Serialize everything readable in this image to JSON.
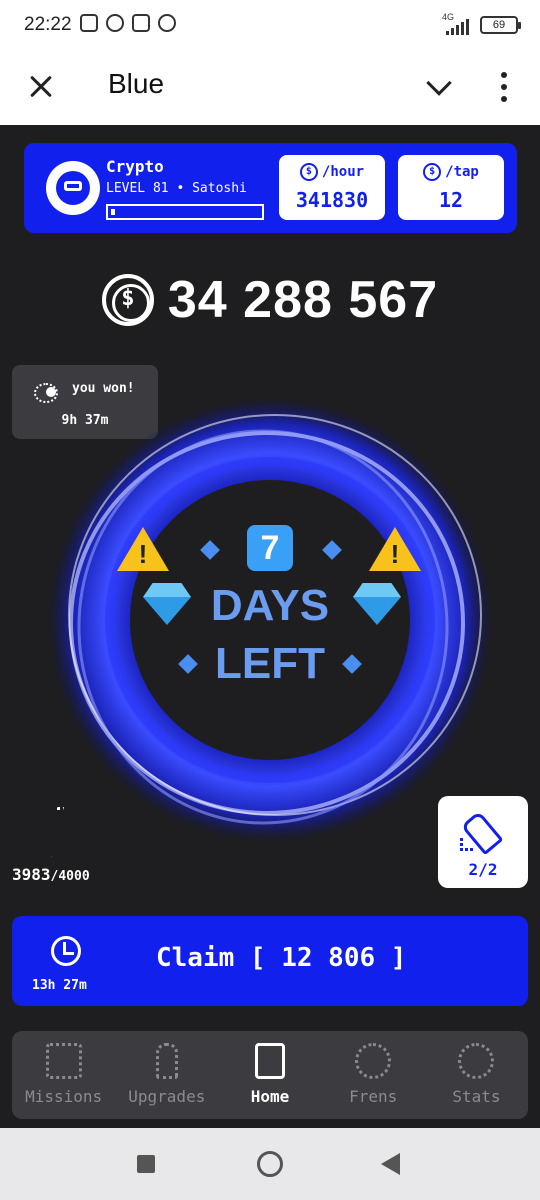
{
  "status_bar": {
    "time": "22:22",
    "network": "4G",
    "battery": "69"
  },
  "app_bar": {
    "title": "Blue"
  },
  "profile": {
    "name": "Crypto",
    "level_text": "LEVEL 81 • Satoshi",
    "level_progress": 0.03
  },
  "stats": {
    "hour_label": "/hour",
    "hour_value": "341830",
    "tap_label": "/tap",
    "tap_value": "12"
  },
  "balance": "34 288 567",
  "coin_symbol": "$",
  "won": {
    "label": "you won!",
    "timer": "9h 37m"
  },
  "tap_circle": {
    "seven": "7",
    "line1": "DAYS",
    "line2": "LEFT"
  },
  "energy": {
    "current": "3983",
    "max": "/4000"
  },
  "boost": {
    "count": "2/2"
  },
  "claim": {
    "label": "Claim [ 12 806 ]",
    "timer": "13h 27m"
  },
  "nav": [
    {
      "label": "Missions",
      "icon": "missions-icon"
    },
    {
      "label": "Upgrades",
      "icon": "upgrades-icon"
    },
    {
      "label": "Home",
      "icon": "home-icon"
    },
    {
      "label": "Frens",
      "icon": "frens-icon"
    },
    {
      "label": "Stats",
      "icon": "stats-icon"
    }
  ],
  "colors": {
    "brand": "#1220ee",
    "background": "#1e1e20",
    "panel": "#3b3b40",
    "accent_text": "#6b9cf0"
  }
}
